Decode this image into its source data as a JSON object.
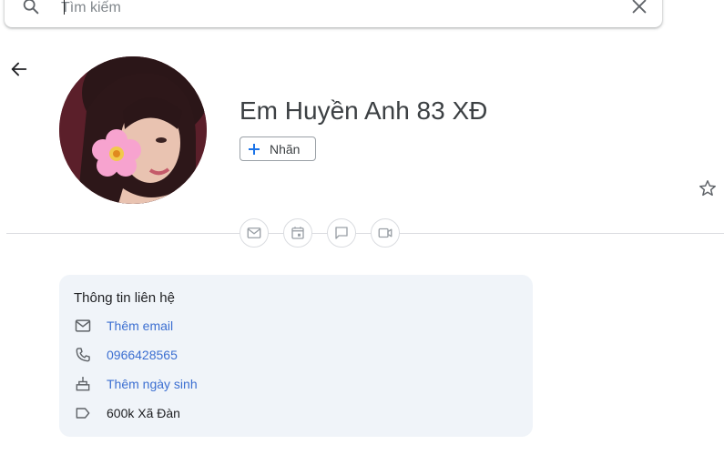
{
  "search": {
    "placeholder": "Tìm kiếm"
  },
  "contact": {
    "name": "Em Huyền Anh 83 XĐ",
    "label_button": "Nhãn"
  },
  "info": {
    "title": "Thông tin liên hệ",
    "rows": [
      {
        "icon": "mail-icon",
        "text": "Thêm email"
      },
      {
        "icon": "phone-icon",
        "text": "0966428565"
      },
      {
        "icon": "cake-icon",
        "text": "Thêm ngày sinh"
      },
      {
        "icon": "label-icon",
        "text": "600k Xã Đàn"
      }
    ]
  },
  "colors": {
    "link": "#3c6fd1",
    "card_bg": "#f0f4f9",
    "accent": "#1a73e8"
  }
}
